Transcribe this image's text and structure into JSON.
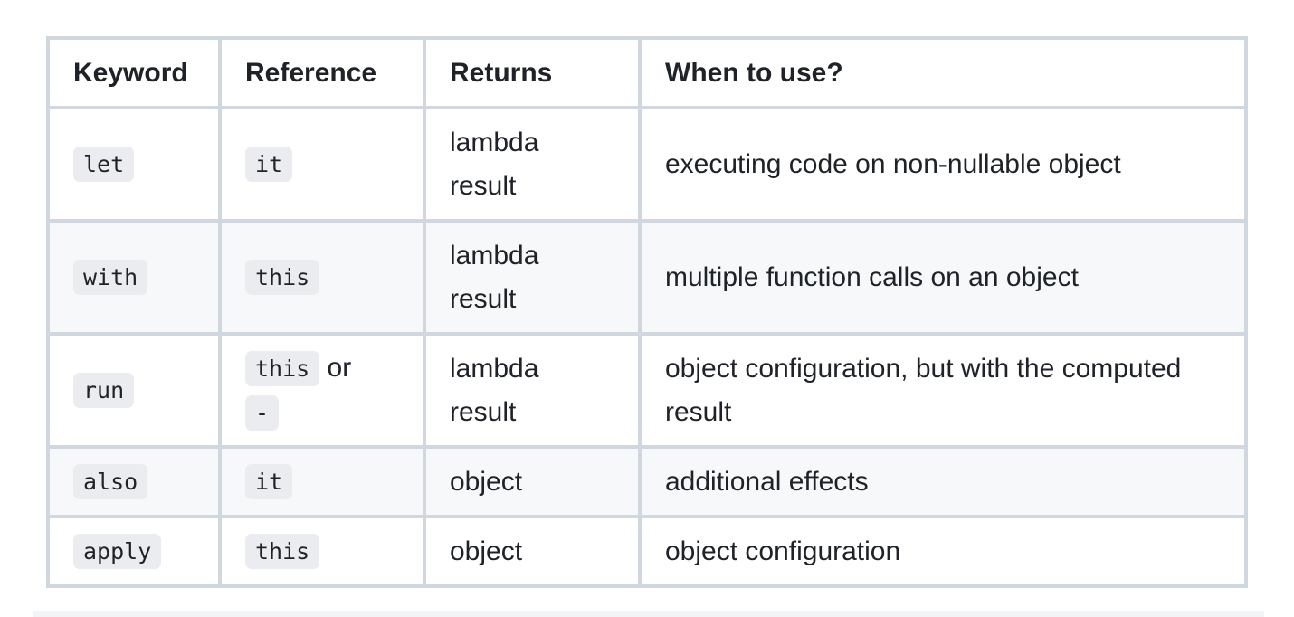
{
  "table": {
    "headers": [
      "Keyword",
      "Reference",
      "Returns",
      "When to use?"
    ],
    "rows": [
      {
        "keyword": "let",
        "reference": "it",
        "reference_suffix": "",
        "reference_extra": "",
        "returns": [
          "lambda",
          "result"
        ],
        "when": "executing code on non-nullable object"
      },
      {
        "keyword": "with",
        "reference": "this",
        "reference_suffix": "",
        "reference_extra": "",
        "returns": [
          "lambda",
          "result"
        ],
        "when": "multiple function calls on an object"
      },
      {
        "keyword": "run",
        "reference": "this",
        "reference_suffix": " or",
        "reference_extra": "-",
        "returns": [
          "lambda",
          "result"
        ],
        "when": "object configuration, but with the computed result"
      },
      {
        "keyword": "also",
        "reference": "it",
        "reference_suffix": "",
        "reference_extra": "",
        "returns": [
          "object"
        ],
        "when": "additional effects"
      },
      {
        "keyword": "apply",
        "reference": "this",
        "reference_suffix": "",
        "reference_extra": "",
        "returns": [
          "object"
        ],
        "when": "object configuration"
      }
    ]
  },
  "colors": {
    "border": "#d0d7de",
    "row_alt_bg": "#f6f8fa",
    "code_bg": "#eaecef",
    "text": "#1f2328"
  }
}
